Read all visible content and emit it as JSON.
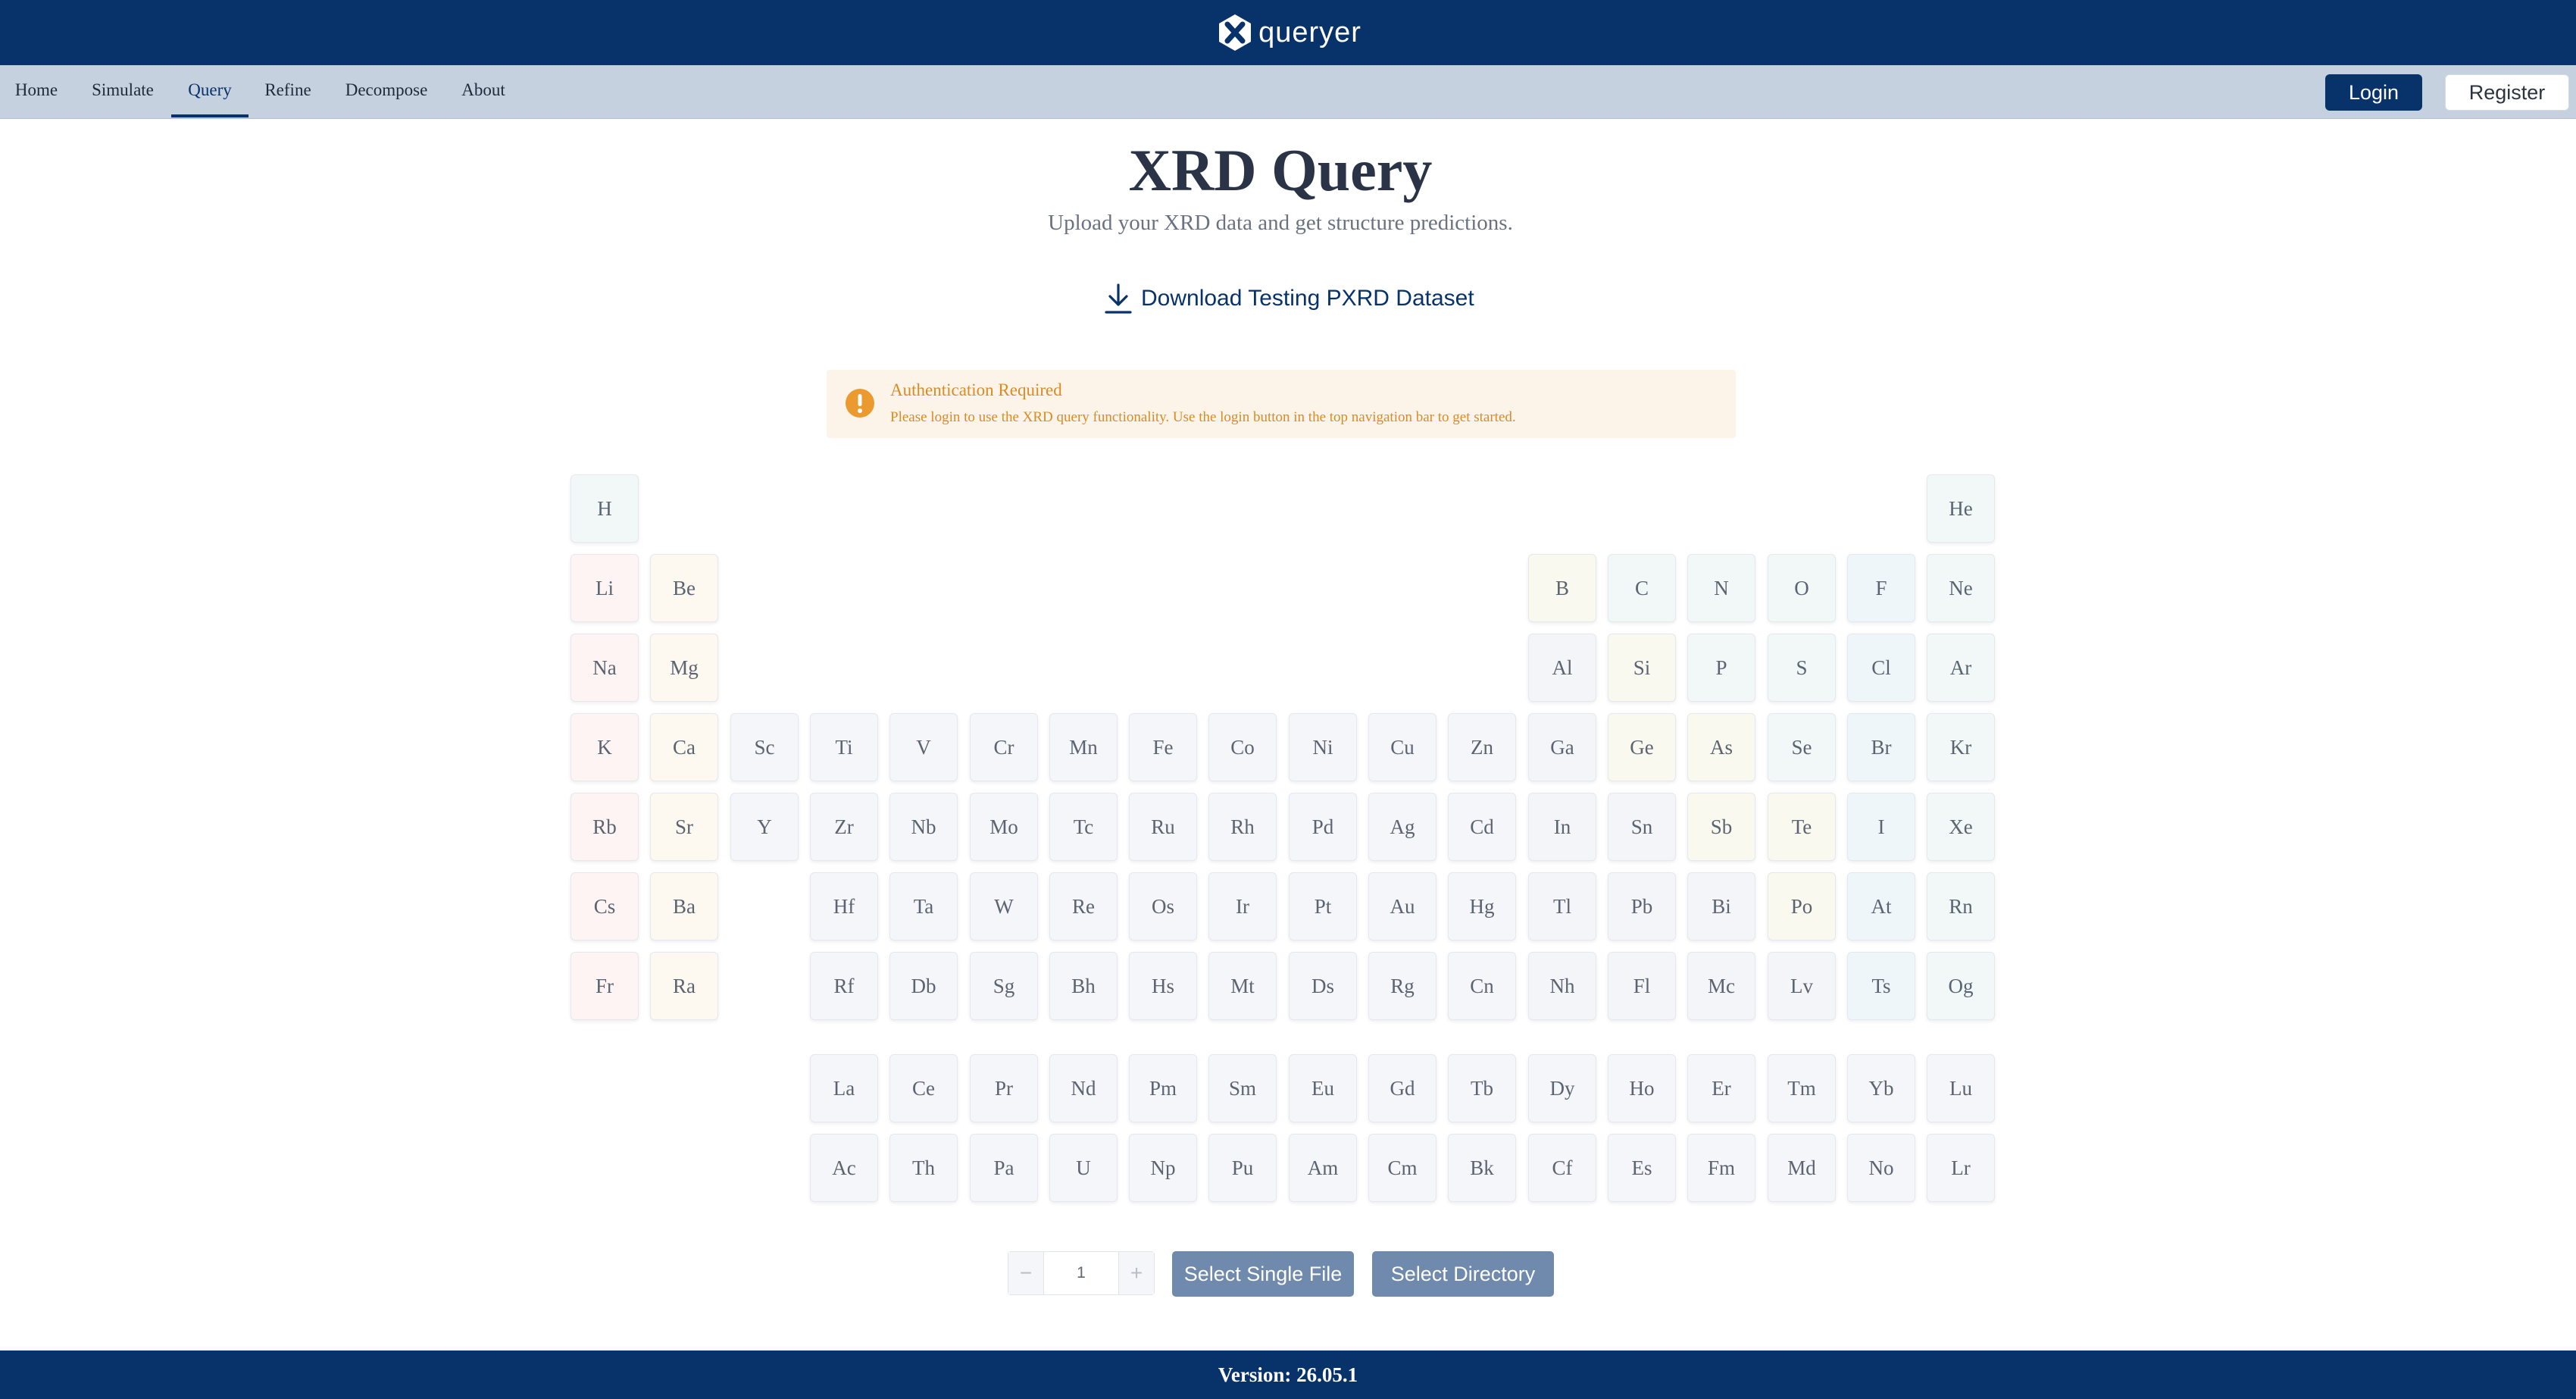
{
  "brand": {
    "name": "queryer",
    "logo_icon": "x-hexagon-logo-icon"
  },
  "nav": {
    "items": [
      "Home",
      "Simulate",
      "Query",
      "Refine",
      "Decompose",
      "About"
    ],
    "active": "Query",
    "login_label": "Login",
    "register_label": "Register"
  },
  "header": {
    "title": "XRD Query",
    "subtitle": "Upload your XRD data and get structure predictions."
  },
  "download": {
    "label": "Download Testing PXRD Dataset",
    "icon": "download-icon"
  },
  "alert": {
    "title": "Authentication Required",
    "description": "Please login to use the XRD query functionality. Use the login button in the top navigation bar to get started.",
    "icon": "exclamation-circle-icon",
    "color": "#dc8a22"
  },
  "periodic_table": {
    "rows": [
      [
        "H",
        "",
        "",
        "",
        "",
        "",
        "",
        "",
        "",
        "",
        "",
        "",
        "",
        "",
        "",
        "",
        "",
        "He"
      ],
      [
        "Li",
        "Be",
        "",
        "",
        "",
        "",
        "",
        "",
        "",
        "",
        "",
        "",
        "B",
        "C",
        "N",
        "O",
        "F",
        "Ne"
      ],
      [
        "Na",
        "Mg",
        "",
        "",
        "",
        "",
        "",
        "",
        "",
        "",
        "",
        "",
        "Al",
        "Si",
        "P",
        "S",
        "Cl",
        "Ar"
      ],
      [
        "K",
        "Ca",
        "Sc",
        "Ti",
        "V",
        "Cr",
        "Mn",
        "Fe",
        "Co",
        "Ni",
        "Cu",
        "Zn",
        "Ga",
        "Ge",
        "As",
        "Se",
        "Br",
        "Kr"
      ],
      [
        "Rb",
        "Sr",
        "Y",
        "Zr",
        "Nb",
        "Mo",
        "Tc",
        "Ru",
        "Rh",
        "Pd",
        "Ag",
        "Cd",
        "In",
        "Sn",
        "Sb",
        "Te",
        "I",
        "Xe"
      ],
      [
        "Cs",
        "Ba",
        "",
        "Hf",
        "Ta",
        "W",
        "Re",
        "Os",
        "Ir",
        "Pt",
        "Au",
        "Hg",
        "Tl",
        "Pb",
        "Bi",
        "Po",
        "At",
        "Rn"
      ],
      [
        "Fr",
        "Ra",
        "",
        "Rf",
        "Db",
        "Sg",
        "Bh",
        "Hs",
        "Mt",
        "Ds",
        "Rg",
        "Cn",
        "Nh",
        "Fl",
        "Mc",
        "Lv",
        "Ts",
        "Og"
      ]
    ],
    "lanthanides": [
      "La",
      "Ce",
      "Pr",
      "Nd",
      "Pm",
      "Sm",
      "Eu",
      "Gd",
      "Tb",
      "Dy",
      "Ho",
      "Er",
      "Tm",
      "Yb",
      "Lu"
    ],
    "actinides": [
      "Ac",
      "Th",
      "Pa",
      "U",
      "Np",
      "Pu",
      "Am",
      "Cm",
      "Bk",
      "Cf",
      "Es",
      "Fm",
      "Md",
      "No",
      "Lr"
    ],
    "category_colors": {
      "alkali": "#fdf4f3",
      "alkaline": "#fdf8f0",
      "transition": "#f5f6f9",
      "post_transition": "#f4f5f8",
      "metalloid": "#f9f9ef",
      "nonmetal": "#f2f8f8",
      "halogen": "#eff6fa",
      "noble": "#f2f8f8",
      "f_block": "#f5f6f9"
    }
  },
  "controls": {
    "count_value": "1",
    "minus": "−",
    "plus": "+",
    "select_file_label": "Select Single File",
    "select_dir_label": "Select Directory"
  },
  "footer": {
    "version": "Version: 26.05.1"
  }
}
